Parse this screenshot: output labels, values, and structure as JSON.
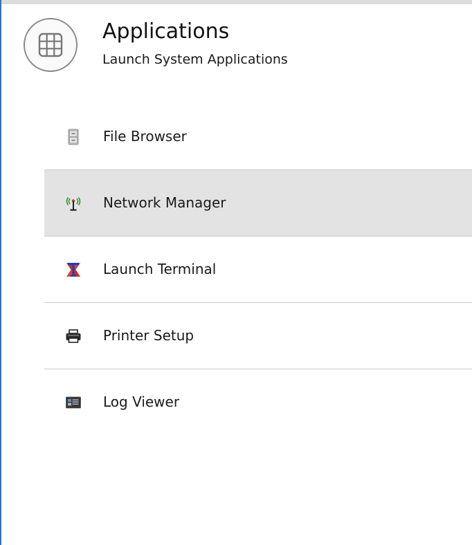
{
  "header": {
    "title": "Applications",
    "subtitle": "Launch System Applications",
    "icon": "grid-apps-icon"
  },
  "menu": {
    "items": [
      {
        "label": "File Browser",
        "icon": "file-cabinet-icon",
        "highlighted": false
      },
      {
        "label": "Network Manager",
        "icon": "antenna-signal-icon",
        "highlighted": true
      },
      {
        "label": "Launch Terminal",
        "icon": "x-terminal-icon",
        "highlighted": false
      },
      {
        "label": "Printer Setup",
        "icon": "printer-icon",
        "highlighted": false
      },
      {
        "label": "Log Viewer",
        "icon": "log-viewer-icon",
        "highlighted": false
      }
    ]
  },
  "colors": {
    "highlight": "#e3e3e3",
    "divider": "#c8c8c8",
    "window_border": "#3a6fb5",
    "antenna_green": "#2e9a2e",
    "terminal_red": "#d03020",
    "terminal_blue": "#1f3fb8"
  }
}
